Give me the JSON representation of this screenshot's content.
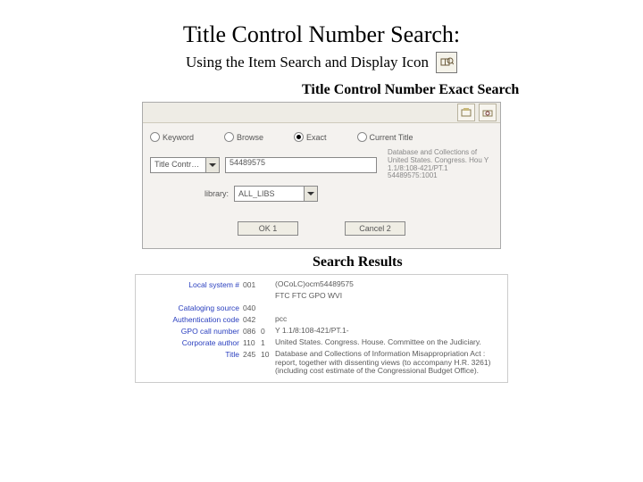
{
  "title": "Title Control Number Search:",
  "subtitle": "Using the Item Search and Display Icon",
  "section1_label": "Title Control Number Exact Search",
  "section2_label": "Search Results",
  "dialog": {
    "radios": {
      "keyword": "Keyword",
      "browse": "Browse",
      "exact": "Exact",
      "current_title": "Current Title"
    },
    "field_combo": "Title Contro ▾",
    "field_value": "54489575",
    "library_label": "library:",
    "library_value": "ALL_LIBS",
    "side_text": "Database and Collections of\nUnited States. Congress. Hou\nY 1.1/8:108-421/PT.1\n54489575:1001",
    "ok": "OK  1",
    "cancel": "Cancel  2"
  },
  "results_rows": [
    {
      "label": "Local system #",
      "code": "001",
      "ind": "",
      "val": "(OCoLC)ocm54489575"
    },
    {
      "label": "",
      "code": "",
      "ind": "",
      "val": "FTC FTC GPO WVI"
    },
    {
      "label": "Cataloging source",
      "code": "040",
      "ind": "",
      "val": ""
    },
    {
      "label": "Authentication code",
      "code": "042",
      "ind": "",
      "val": "pcc"
    },
    {
      "label": "GPO call number",
      "code": "086",
      "ind": "0",
      "val": "Y 1.1/8:108-421/PT.1-"
    },
    {
      "label": "Corporate author",
      "code": "110",
      "ind": "1",
      "val": "United States. Congress. House. Committee on the Judiciary."
    },
    {
      "label": "Title",
      "code": "245",
      "ind": "10",
      "val": "Database and Collections of Information Misappropriation Act : report, together with dissenting views (to accompany H.R. 3261) (including cost estimate of the Congressional Budget Office)."
    }
  ]
}
